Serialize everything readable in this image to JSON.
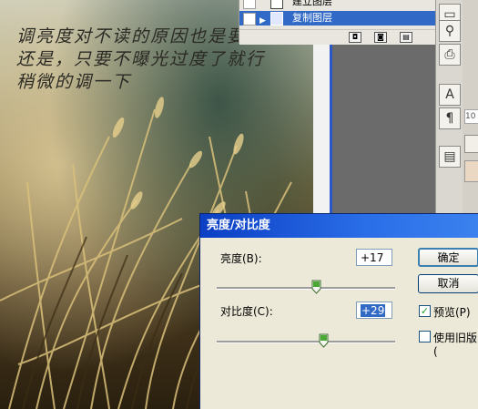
{
  "caption": {
    "line1": "调亮度对不读的原因也是要调亮",
    "line2": "还是，只要不曝光过度了就行",
    "line3": "稍微的调一下"
  },
  "layers_panel": {
    "rows": [
      {
        "name": "建立图层",
        "selected": false
      },
      {
        "name": "复制图层",
        "selected": true
      }
    ]
  },
  "side_panel": {
    "number": "10"
  },
  "dialog": {
    "title": "亮度/对比度",
    "brightness": {
      "label": "亮度(B):",
      "value": "+17",
      "level": 17
    },
    "contrast": {
      "label": "对比度(C):",
      "value": "+29",
      "level": 29
    },
    "ok_label": "确定",
    "cancel_label": "取消",
    "preview": {
      "label": "预览(P)",
      "checked": true
    },
    "legacy": {
      "label": "使用旧版(",
      "checked": false
    }
  }
}
